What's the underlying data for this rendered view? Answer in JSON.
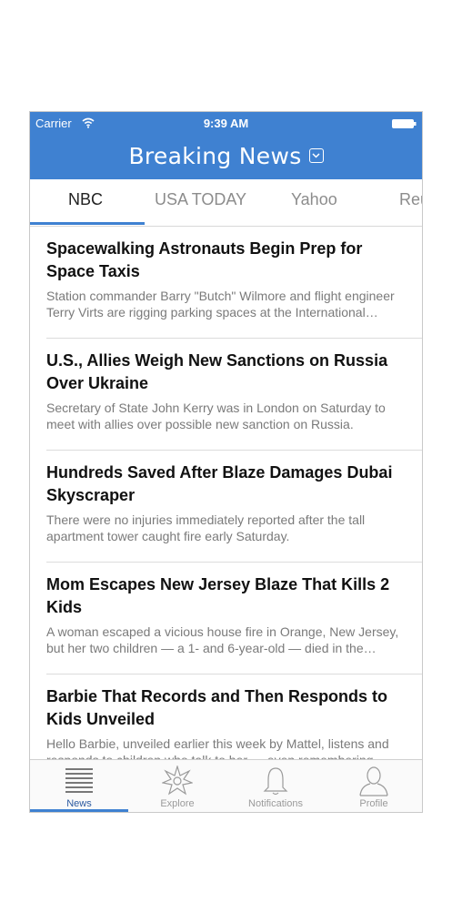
{
  "status": {
    "carrier": "Carrier",
    "time": "9:39 AM"
  },
  "header": {
    "title": "Breaking News"
  },
  "tabs": [
    "NBC",
    "USA TODAY",
    "Yahoo",
    "Reu"
  ],
  "articles": [
    {
      "title": "Spacewalking Astronauts Begin Prep for Space Taxis",
      "summary": "Station commander Barry \"Butch\" Wilmore and flight engineer Terry Virts are rigging parking spaces at the International Space Station."
    },
    {
      "title": "U.S., Allies Weigh New Sanctions on Russia Over Ukraine",
      "summary": "Secretary of State John Kerry was in London on Saturday to meet with allies over possible new sanction on Russia."
    },
    {
      "title": "Hundreds Saved After Blaze Damages Dubai Skyscraper",
      "summary": "There were no injuries immediately reported after the tall apartment tower caught fire early Saturday."
    },
    {
      "title": "Mom Escapes New Jersey Blaze That Kills 2 Kids",
      "summary": "A woman escaped a vicious house fire in Orange, New Jersey, but her two children — a 1- and 6-year-old — died in the blaze."
    },
    {
      "title": "Barbie That Records and Then Responds to Kids Unveiled",
      "summary": "Hello Barbie, unveiled earlier this week by Mattel, listens and responds to children who talk to her — even remembering things."
    }
  ],
  "tabbar": [
    {
      "label": "News",
      "icon": "news-icon"
    },
    {
      "label": "Explore",
      "icon": "compass-icon"
    },
    {
      "label": "Notifications",
      "icon": "bell-icon"
    },
    {
      "label": "Profile",
      "icon": "profile-icon"
    }
  ],
  "colors": {
    "accent": "#3f81d1"
  }
}
